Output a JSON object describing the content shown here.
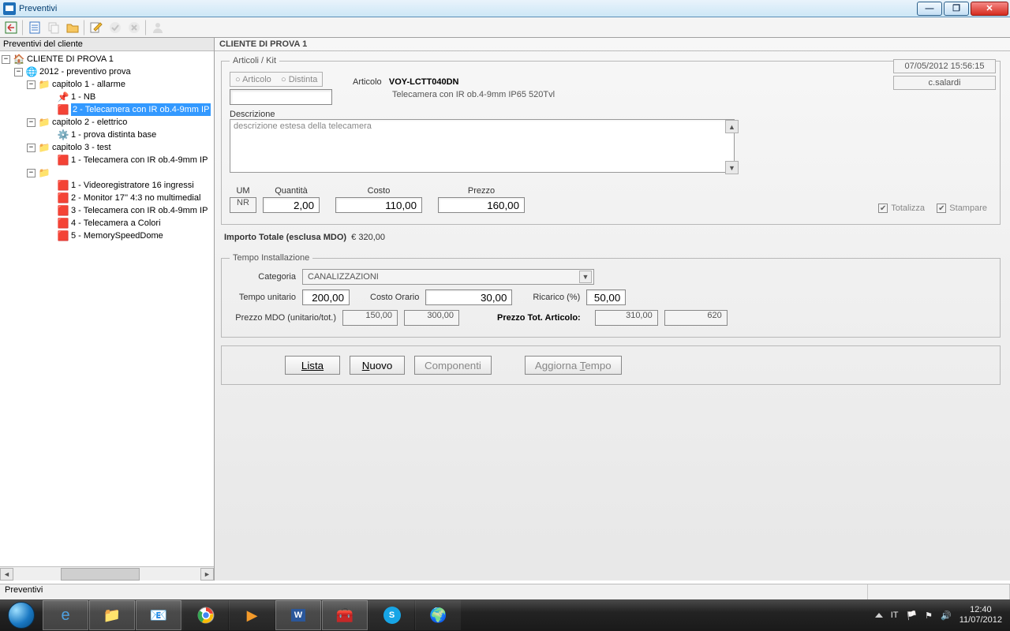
{
  "window": {
    "title": "Preventivi"
  },
  "toolbar_icons": [
    "exit-icon",
    "document-icon",
    "copy-icon",
    "folder-icon",
    "edit-icon",
    "check-icon",
    "cancel-icon",
    "user-icon"
  ],
  "left": {
    "header": "Preventivi del cliente",
    "tree": {
      "root": "CLIENTE DI PROVA 1",
      "quote": "2012 - preventivo prova",
      "cap1": "capitolo 1 - allarme",
      "cap1_items": [
        "1 - NB",
        "2 - Telecamera con IR ob.4-9mm IP"
      ],
      "cap2": "capitolo 2 - elettrico",
      "cap2_items": [
        "1 - prova distinta base"
      ],
      "cap3": "capitolo 3 - test",
      "cap3_items": [
        "1 - Telecamera con IR ob.4-9mm IP"
      ],
      "cap4_items": [
        "1 - Videoregistratore  16 ingressi",
        "2 - Monitor 17'' 4:3 no multimedial",
        "3 - Telecamera con IR ob.4-9mm IP",
        "4 - Telecamera a Colori",
        "5 - MemorySpeedDome"
      ]
    }
  },
  "right": {
    "title": "CLIENTE DI PROVA 1",
    "meta": {
      "datetime": "07/05/2012 15:56:15",
      "user": "c.salardi"
    },
    "articoli": {
      "legend": "Articoli / Kit",
      "radio_articolo": "Articolo",
      "radio_distinta": "Distinta",
      "articolo_label": "Articolo",
      "articolo_code": "VOY-LCTT040DN",
      "articolo_sub": "Telecamera con IR ob.4-9mm IP65 520Tvl",
      "descrizione_label": "Descrizione",
      "descrizione_text": "descrizione estesa della telecamera",
      "um_label": "UM",
      "um": "NR",
      "quantita_label": "Quantità",
      "quantita": "2,00",
      "costo_label": "Costo",
      "costo": "110,00",
      "prezzo_label": "Prezzo",
      "prezzo": "160,00",
      "totalizza": "Totalizza",
      "stampare": "Stampare",
      "importo_label": "Importo Totale (esclusa MDO)",
      "importo_val": "€ 320,00"
    },
    "tempo": {
      "legend": "Tempo Installazione",
      "categoria_label": "Categoria",
      "categoria": "CANALIZZAZIONI",
      "tempo_unitario_label": "Tempo unitario",
      "tempo_unitario": "200,00",
      "costo_orario_label": "Costo Orario",
      "costo_orario": "30,00",
      "ricarico_label": "Ricarico (%)",
      "ricarico": "50,00",
      "prezzo_mdo_label": "Prezzo MDO (unitario/tot.)",
      "prezzo_mdo_u": "150,00",
      "prezzo_mdo_t": "300,00",
      "prezzo_tot_label": "Prezzo Tot. Articolo:",
      "prezzo_tot_u": "310,00",
      "prezzo_tot_t": "620"
    },
    "buttons": {
      "lista": "Lista",
      "nuovo": "Nuovo",
      "componenti": "Componenti",
      "aggiorna": "Aggiorna Tempo"
    }
  },
  "statusbar": "Preventivi",
  "taskbar": {
    "lang": "IT",
    "time": "12:40",
    "date": "11/07/2012"
  }
}
